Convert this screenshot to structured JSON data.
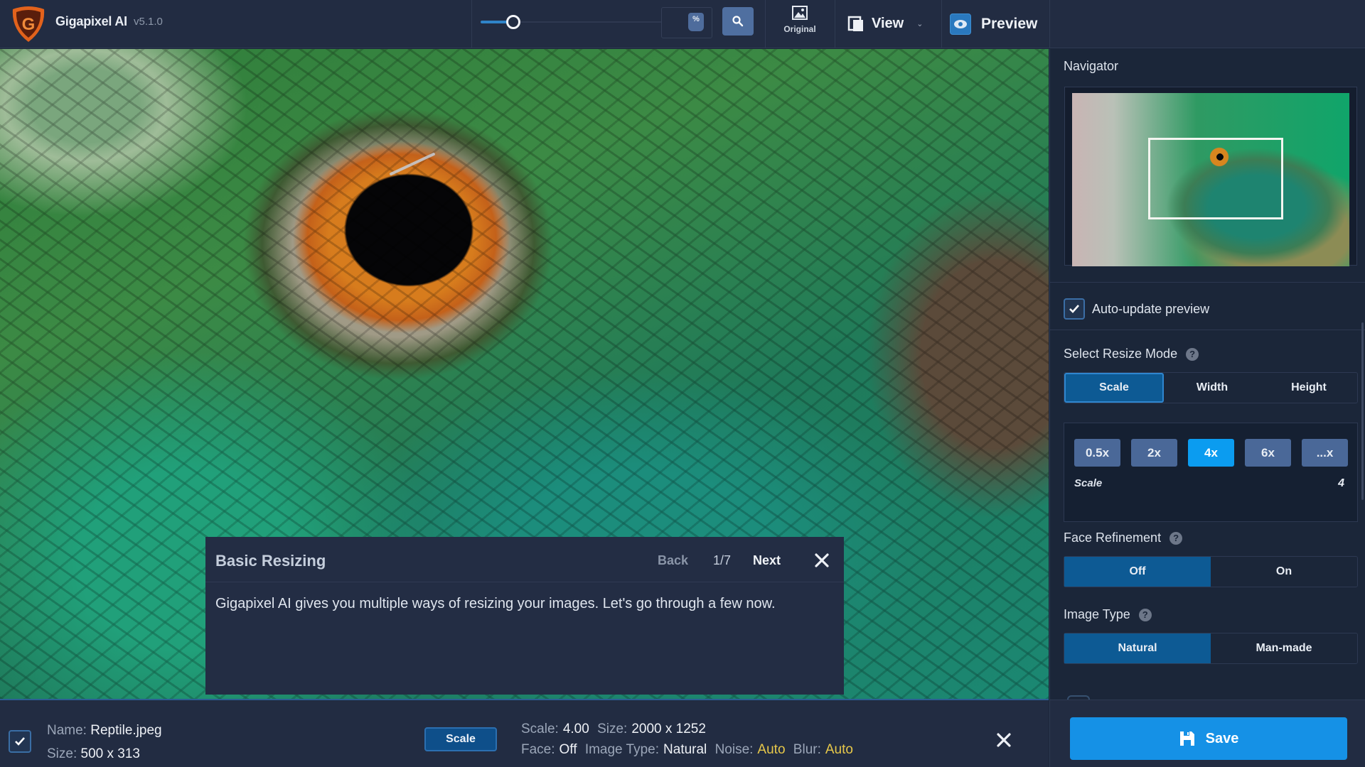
{
  "app": {
    "title": "Gigapixel AI",
    "version": "v5.1.0"
  },
  "toolbar": {
    "zoom_slider_fraction": 0.15,
    "zoom_percent_icon": "%",
    "original_label": "Original",
    "view_label": "View",
    "preview_label": "Preview",
    "icons": {
      "zoom": "magnifier-icon",
      "original": "image-icon",
      "view": "split-view-icon",
      "preview": "eye-icon"
    }
  },
  "tour": {
    "title": "Basic Resizing",
    "back_label": "Back",
    "step": "1/7",
    "next_label": "Next",
    "body": "Gigapixel AI gives you multiple ways of resizing your images. Let's go through a few now."
  },
  "infobar": {
    "checked": true,
    "name_label": "Name:",
    "name_value": "Reptile.jpeg",
    "size_label": "Size:",
    "size_value": "500 x 313",
    "mode_badge": "Scale",
    "scale_label": "Scale:",
    "scale_value": "4.00",
    "out_size_label": "Size:",
    "out_size_value": "2000 x 1252",
    "face_label": "Face:",
    "face_value": "Off",
    "image_type_label": "Image Type:",
    "image_type_value": "Natural",
    "noise_label": "Noise:",
    "noise_value": "Auto",
    "blur_label": "Blur:",
    "blur_value": "Auto"
  },
  "panel": {
    "navigator_label": "Navigator",
    "auto_update": {
      "label": "Auto-update preview",
      "checked": true
    },
    "resize_mode": {
      "label": "Select Resize Mode",
      "options": [
        "Scale",
        "Width",
        "Height"
      ],
      "selected": "Scale"
    },
    "scale": {
      "presets": [
        "0.5x",
        "2x",
        "4x",
        "6x",
        "...x"
      ],
      "selected": "4x",
      "label": "Scale",
      "value": "4"
    },
    "face_refinement": {
      "label": "Face Refinement",
      "options": [
        "Off",
        "On"
      ],
      "selected": "Off"
    },
    "image_type": {
      "label": "Image Type",
      "options": [
        "Natural",
        "Man-made"
      ],
      "selected": "Natural"
    },
    "save_label": "Save"
  },
  "colors": {
    "accent": "#1591e6",
    "active_segment": "#0d5a94",
    "preset_active": "#0b9cf0",
    "preset": "#4a6898",
    "auto_value": "#e7c84a",
    "background": "#1b2639",
    "toolbar": "#222c42",
    "logo": "#e2621c"
  }
}
